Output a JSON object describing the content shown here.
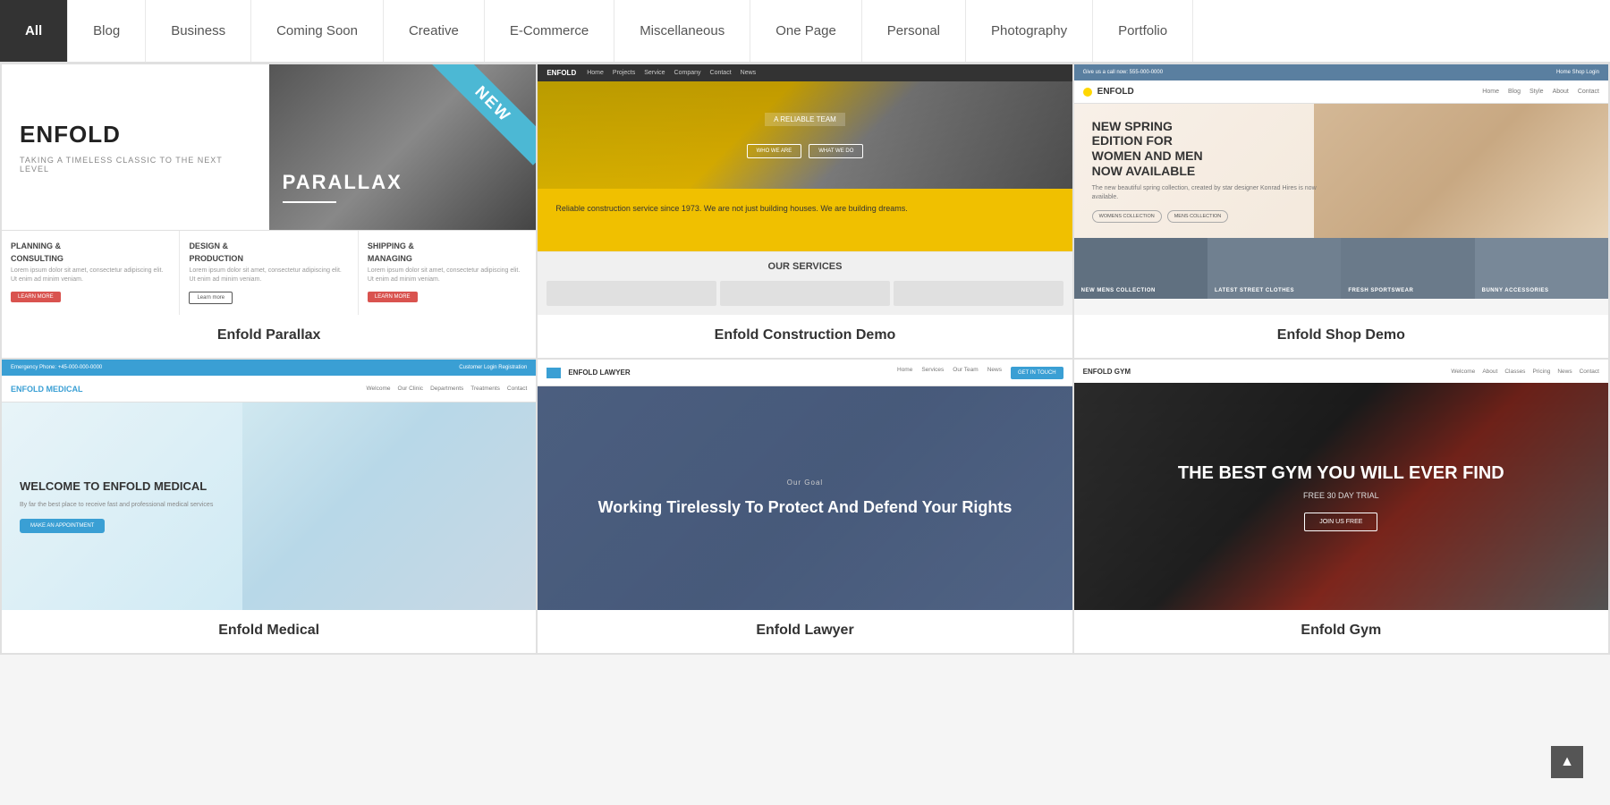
{
  "tabs": [
    {
      "id": "all",
      "label": "All",
      "active": true
    },
    {
      "id": "blog",
      "label": "Blog",
      "active": false
    },
    {
      "id": "business",
      "label": "Business",
      "active": false
    },
    {
      "id": "coming-soon",
      "label": "Coming Soon",
      "active": false
    },
    {
      "id": "creative",
      "label": "Creative",
      "active": false
    },
    {
      "id": "ecommerce",
      "label": "E-Commerce",
      "active": false
    },
    {
      "id": "miscellaneous",
      "label": "Miscellaneous",
      "active": false
    },
    {
      "id": "one-page",
      "label": "One Page",
      "active": false
    },
    {
      "id": "personal",
      "label": "Personal",
      "active": false
    },
    {
      "id": "photography",
      "label": "Photography",
      "active": false
    },
    {
      "id": "portfolio",
      "label": "Portfolio",
      "active": false
    }
  ],
  "demos": [
    {
      "id": "enfold-parallax",
      "label": "Enfold Parallax",
      "badge": "NEW",
      "type": "parallax"
    },
    {
      "id": "enfold-construction",
      "label": "Enfold Construction Demo",
      "badge": null,
      "type": "construction"
    },
    {
      "id": "enfold-shop",
      "label": "Enfold Shop Demo",
      "badge": null,
      "type": "shop"
    },
    {
      "id": "enfold-medical",
      "label": "Enfold Medical",
      "badge": null,
      "type": "medical"
    },
    {
      "id": "enfold-lawyer",
      "label": "Enfold Lawyer",
      "badge": null,
      "type": "lawyer"
    },
    {
      "id": "enfold-gym",
      "label": "Enfold Gym",
      "badge": null,
      "type": "gym"
    }
  ],
  "parallax": {
    "logo": "ENFOLD",
    "tagline": "TAKING A TIMELESS CLASSIC TO THE NEXT LEVEL",
    "bg_text": "PARALLAX",
    "boxes": [
      {
        "title": "PLANNING &",
        "title2": "CONSULTING",
        "text": "Lorem ipsum dolor sit amet, consectetur adipiscing elit. Ut enim ad minim veniam.",
        "btn": "LEARN MORE",
        "btn_style": "red"
      },
      {
        "title": "DESIGN &",
        "title2": "PRODUCTION",
        "text": "Lorem ipsum dolor sit amet, consectetur adipiscing elit. Ut enim ad minim veniam.",
        "btn": "Learn more",
        "btn_style": "outline"
      },
      {
        "title": "SHIPPING &",
        "title2": "MANAGING",
        "text": "Lorem ipsum dolor sit amet, consectetur adipiscing elit. Ut enim ad minim veniam.",
        "btn": "LEARN MORE",
        "btn_style": "red"
      }
    ]
  },
  "construction": {
    "logo": "ENFOLD",
    "nav_links": [
      "Home",
      "Projects",
      "Service",
      "Company",
      "Contact",
      "News"
    ],
    "hero_badge": "A RELIABLE TEAM",
    "hero_text": "Reliable construction service since 1973. We are not just building houses. We are building dreams.",
    "services_title": "OUR SERVICES",
    "btn1": "WHO WE ARE",
    "btn2": "WHAT WE DO"
  },
  "shop": {
    "topbar_left": "Give us a call now: 555-000-0000",
    "topbar_right": "Home   Shop   Login",
    "logo": "ENFOLD",
    "nav_links": [
      "Home",
      "Blog",
      "Style",
      "About",
      "Contact"
    ],
    "hero_title": "NEW SPRING EDITION FOR WOMEN AND MEN NOW AVAILABLE",
    "hero_sub": "The new beautiful spring collection, created by star designer Konrad Hires is now available.",
    "btn1": "WOMENS COLLECTION",
    "btn2": "MENS COLLECTION",
    "categories": [
      "NEW MENS COLLECTION",
      "LATEST STREET CLOTHES",
      "FRESH SPORTSWEAR",
      "BUNNY ACCESSORIES"
    ]
  },
  "medical": {
    "topbar_left": "Emergency Phone: +45-000-000-0000",
    "topbar_right": "Customer Login   Registration",
    "logo": "ENFOLD MEDICAL",
    "nav_links": [
      "Welcome",
      "Our Clinic",
      "Departments",
      "Treatments",
      "Contact"
    ],
    "hero_title": "WELCOME TO ENFOLD MEDICAL",
    "hero_sub": "By far the best place to receive fast and professional medical services",
    "btn": "MAKE AN APPOINTMENT"
  },
  "lawyer": {
    "logo": "ENFOLD LAWYER",
    "nav_links": [
      "Home",
      "Services",
      "Our Team",
      "News"
    ],
    "nav_btn": "GET IN TOUCH",
    "hero_tag": "Our Goal",
    "hero_title": "Working Tirelessly To Protect And Defend Your Rights"
  },
  "gym": {
    "logo": "ENFOLD GYM",
    "nav_links": [
      "Welcome",
      "About",
      "Classes",
      "Pricing",
      "News",
      "Contact"
    ],
    "hero_title": "THE BEST GYM YOU WILL EVER FIND",
    "hero_sub": "FREE 30 DAY TRIAL",
    "btn": "JOIN US FREE"
  },
  "scroll_top": "▲"
}
